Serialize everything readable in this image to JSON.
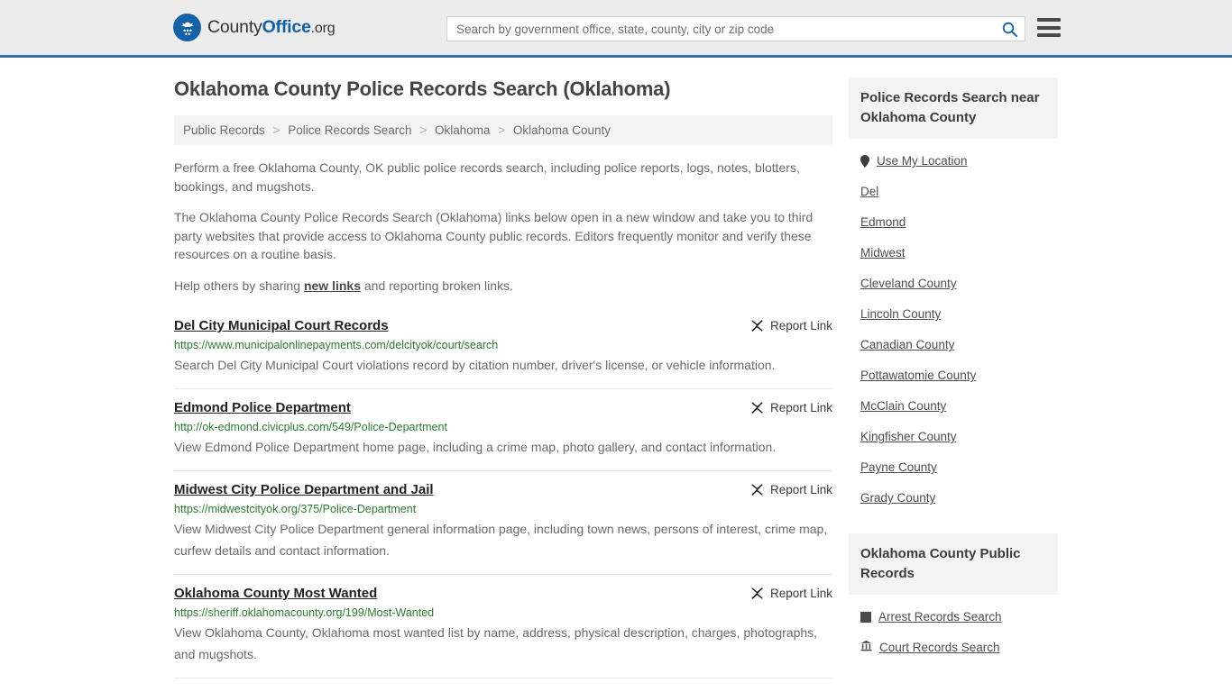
{
  "header": {
    "logo": {
      "icon": "eagle-seal-icon",
      "part1": "County",
      "part2": "Office",
      "part3": ".org"
    },
    "search": {
      "placeholder": "Search by government office, state, county, city or zip code",
      "value": "",
      "search_icon": "search-icon"
    },
    "menu_icon": "hamburger-menu-icon"
  },
  "page": {
    "title": "Oklahoma County Police Records Search (Oklahoma)",
    "breadcrumb": [
      "Public Records",
      "Police Records Search",
      "Oklahoma",
      "Oklahoma County"
    ],
    "breadcrumb_separator": ">",
    "intro": [
      "Perform a free Oklahoma County, OK public police records search, including police reports, logs, notes, blotters, bookings, and mugshots.",
      "The Oklahoma County Police Records Search (Oklahoma) links below open in a new window and take you to third party websites that provide access to Oklahoma County public records. Editors frequently monitor and verify these resources on a routine basis."
    ],
    "help_prefix": "Help others by sharing ",
    "help_link": "new links",
    "help_suffix": " and reporting broken links."
  },
  "results": {
    "report_label": "Report Link",
    "report_icon": "broken-link-icon",
    "items": [
      {
        "title": "Del City Municipal Court Records",
        "url": "https://www.municipalonlinepayments.com/delcityok/court/search",
        "description": "Search Del City Municipal Court violations record by citation number, driver's license, or vehicle information."
      },
      {
        "title": "Edmond Police Department",
        "url": "http://ok-edmond.civicplus.com/549/Police-Department",
        "description": "View Edmond Police Department home page, including a crime map, photo gallery, and contact information."
      },
      {
        "title": "Midwest City Police Department and Jail",
        "url": "https://midwestcityok.org/375/Police-Department",
        "description": "View Midwest City Police Department general information page, including town news, persons of interest, crime map, curfew details and contact information."
      },
      {
        "title": "Oklahoma County Most Wanted",
        "url": "https://sheriff.oklahomacounty.org/199/Most-Wanted",
        "description": "View Oklahoma County, Oklahoma most wanted list by name, address, physical description, charges, photographs, and mugshots."
      }
    ]
  },
  "sidebar": {
    "nearby": {
      "title": "Police Records Search near Oklahoma County",
      "use_my_location": {
        "label": "Use My Location",
        "icon": "map-pin-icon"
      },
      "links": [
        "Del",
        "Edmond",
        "Midwest",
        "Cleveland County",
        "Lincoln County",
        "Canadian County",
        "Pottawatomie County",
        "McClain County",
        "Kingfisher County",
        "Payne County",
        "Grady County"
      ]
    },
    "public_records": {
      "title": "Oklahoma County Public Records",
      "links": [
        {
          "label": "Arrest Records Search",
          "icon": "document-square-icon"
        },
        {
          "label": "Court Records Search",
          "icon": "courthouse-icon"
        }
      ]
    }
  },
  "colors": {
    "brand_blue": "#1461a8",
    "header_border": "#3a6ea5",
    "url_green": "#2f7a32",
    "header_bg": "#ececec",
    "panel_bg": "#f4f4f4"
  }
}
